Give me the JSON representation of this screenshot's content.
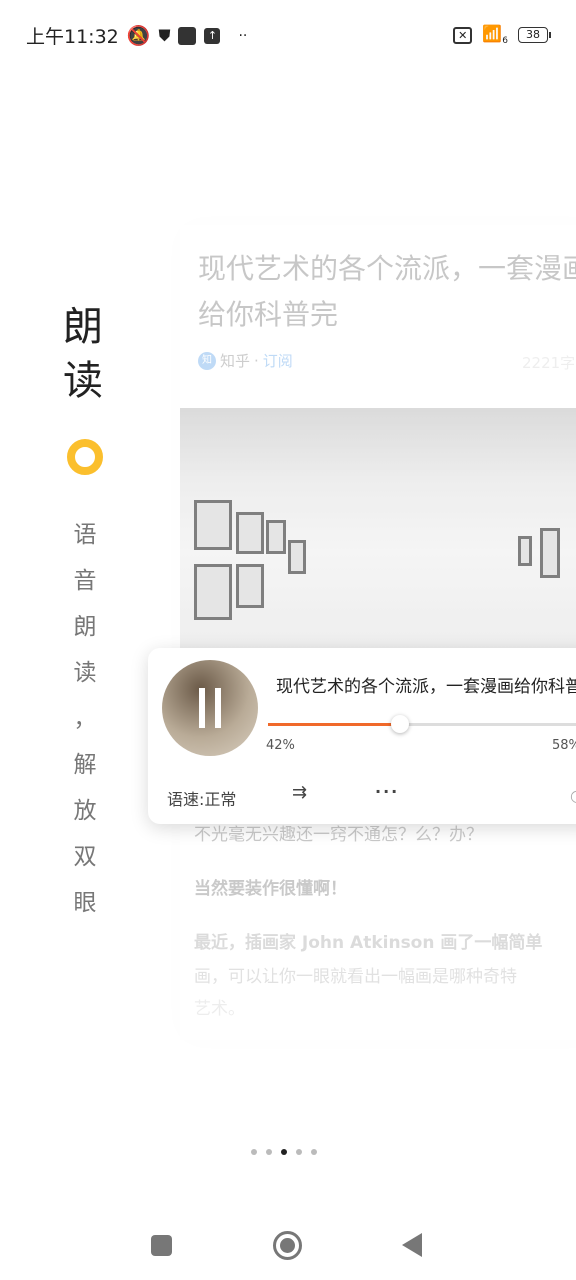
{
  "status_bar": {
    "time": "上午11:32",
    "battery": "38",
    "wifi_badge": "6"
  },
  "article": {
    "title_line1": "现代艺术的各个流派，一套漫画",
    "title_line2": "给你科普完",
    "source_badge": "知",
    "source": "知乎",
    "source_sep": "·",
    "subscribe": "订阅",
    "word_count": "2221字",
    "para1": "不光毫无兴趣还一窍不通怎？么？办？",
    "para2": "当然要装作很懂啊！",
    "para3_line1": "最近，插画家 John Atkinson 画了一幅简单",
    "para3_line2": "画，可以让你一眼就看出一幅画是哪种奇特",
    "para3_line3": "艺术。"
  },
  "player": {
    "title": "现代艺术的各个流派，一套漫画给你科普完",
    "progress_percent": 42,
    "played_label": "42%",
    "remaining_label": "58%",
    "speed_label": "语速:正常",
    "accent_color": "#f0692a"
  },
  "feature": {
    "title_chars": [
      "朗",
      "读"
    ],
    "accent_color": "#fbbf2d",
    "subtitle_chars": [
      "语",
      "音",
      "朗",
      "读",
      "，",
      "解",
      "放",
      "双",
      "眼"
    ]
  },
  "pager": {
    "count": 5,
    "active_index": 2
  }
}
